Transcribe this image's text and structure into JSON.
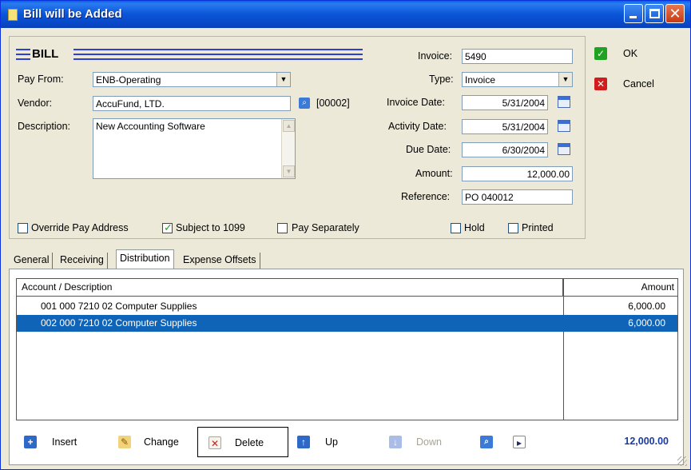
{
  "window": {
    "title": "Bill will be Added"
  },
  "form": {
    "heading": "BILL",
    "pay_from": {
      "label": "Pay From:",
      "value": "ENB-Operating"
    },
    "vendor": {
      "label": "Vendor:",
      "value": "AccuFund, LTD.",
      "code": "[00002]"
    },
    "description": {
      "label": "Description:",
      "value": "New Accounting Software"
    },
    "invoice": {
      "label": "Invoice:",
      "value": "5490"
    },
    "type": {
      "label": "Type:",
      "value": "Invoice"
    },
    "invoice_date": {
      "label": "Invoice Date:",
      "value": "5/31/2004"
    },
    "activity_date": {
      "label": "Activity Date:",
      "value": "5/31/2004"
    },
    "due_date": {
      "label": "Due Date:",
      "value": "6/30/2004"
    },
    "amount": {
      "label": "Amount:",
      "value": "12,000.00"
    },
    "reference": {
      "label": "Reference:",
      "value": "PO 040012"
    },
    "checks": {
      "override_pay_address": {
        "label": "Override Pay Address",
        "checked": false
      },
      "subject_to_1099": {
        "label": "Subject to 1099",
        "checked": true
      },
      "pay_separately": {
        "label": "Pay Separately",
        "checked": false
      },
      "hold": {
        "label": "Hold",
        "checked": false
      },
      "printed": {
        "label": "Printed",
        "checked": false
      }
    }
  },
  "side_buttons": {
    "ok": "OK",
    "cancel": "Cancel"
  },
  "tabs": [
    {
      "label": "General",
      "active": false
    },
    {
      "label": "Receiving",
      "active": false
    },
    {
      "label": "Distribution",
      "active": true
    },
    {
      "label": "Expense Offsets",
      "active": false
    }
  ],
  "grid": {
    "columns": [
      "Account / Description",
      "Amount"
    ],
    "rows": [
      {
        "account": "001 000 7210 02  Computer Supplies",
        "amount": "6,000.00",
        "selected": false
      },
      {
        "account": "002 000 7210 02  Computer Supplies",
        "amount": "6,000.00",
        "selected": true
      }
    ]
  },
  "toolbar": {
    "insert": "Insert",
    "change": "Change",
    "delete": "Delete",
    "up": "Up",
    "down": "Down",
    "total": "12,000.00"
  },
  "icons": [
    "document-icon",
    "search-icon",
    "calendar-icon",
    "check-icon",
    "x-icon",
    "insert-icon",
    "change-icon",
    "delete-icon",
    "up-arrow-icon",
    "down-arrow-icon",
    "export-icon"
  ],
  "colors": {
    "title_bar": "#0a55d8",
    "selection": "#1064b8",
    "total_text": "#1a3aa6",
    "ok_green": "#21a121",
    "cancel_red": "#d01c1c"
  }
}
